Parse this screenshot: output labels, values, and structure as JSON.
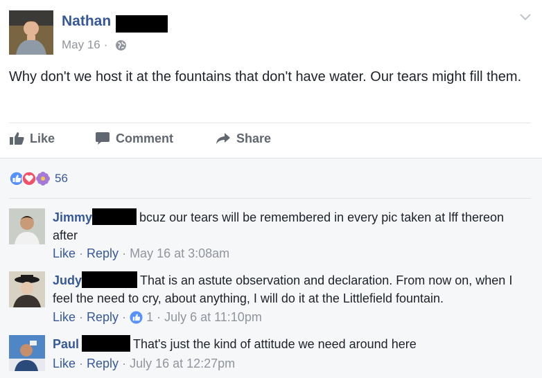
{
  "post": {
    "author": "Nathan",
    "date": "May 16",
    "text": "Why don't we host it at the fountains that don't have water. Our tears might fill them.",
    "actions": {
      "like": "Like",
      "comment": "Comment",
      "share": "Share"
    },
    "reaction_count": "56"
  },
  "comments": [
    {
      "name": "Jimmy",
      "text": "bcuz our tears will be remembered in every pic taken at lff thereon after",
      "like_label": "Like",
      "reply_label": "Reply",
      "timestamp": "May 16 at 3:08am"
    },
    {
      "name": "Judy",
      "text": "That is an astute observation and declaration. From now on, when I feel the need to cry, about anything, I will do it at the Littlefield fountain.",
      "like_label": "Like",
      "reply_label": "Reply",
      "likes": "1",
      "timestamp": "July 6 at 11:10pm"
    },
    {
      "name": "Paul",
      "text": "That's just the kind of attitude we need around here",
      "like_label": "Like",
      "reply_label": "Reply",
      "timestamp": "July 16 at 12:27pm"
    }
  ],
  "colors": {
    "link": "#365899",
    "meta": "#90949c",
    "text": "#1d2129",
    "like_blue": "#5890ff",
    "love_red": "#f25268"
  }
}
